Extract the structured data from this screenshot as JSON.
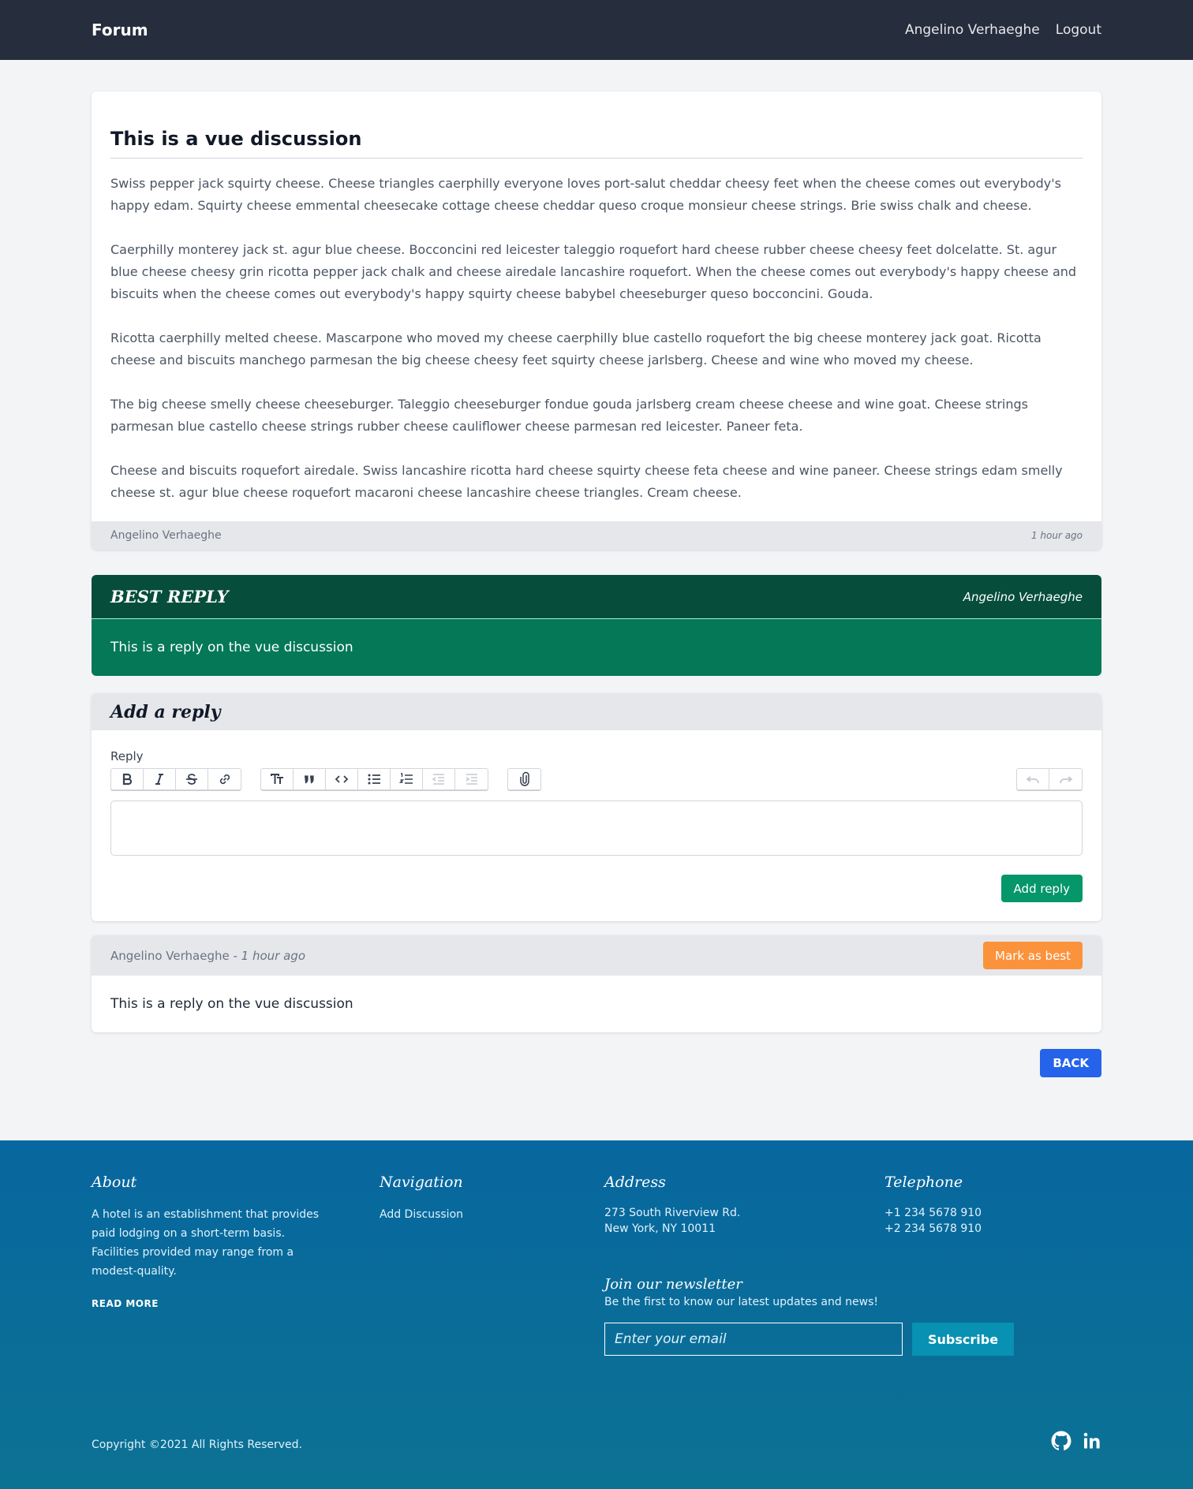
{
  "navbar": {
    "brand": "Forum",
    "user": "Angelino Verhaeghe",
    "logout": "Logout"
  },
  "discussion": {
    "title": "This is a vue discussion",
    "paragraphs": [
      "Swiss pepper jack squirty cheese. Cheese triangles caerphilly everyone loves port-salut cheddar cheesy feet when the cheese comes out everybody's happy edam. Squirty cheese emmental cheesecake cottage cheese cheddar queso croque monsieur cheese strings. Brie swiss chalk and cheese.",
      "Caerphilly monterey jack st. agur blue cheese. Bocconcini red leicester taleggio roquefort hard cheese rubber cheese cheesy feet dolcelatte. St. agur blue cheese cheesy grin ricotta pepper jack chalk and cheese airedale lancashire roquefort. When the cheese comes out everybody's happy cheese and biscuits when the cheese comes out everybody's happy squirty cheese babybel cheeseburger queso bocconcini. Gouda.",
      "Ricotta caerphilly melted cheese. Mascarpone who moved my cheese caerphilly blue castello roquefort the big cheese monterey jack goat. Ricotta cheese and biscuits manchego parmesan the big cheese cheesy feet squirty cheese jarlsberg. Cheese and wine who moved my cheese.",
      "The big cheese smelly cheese cheeseburger. Taleggio cheeseburger fondue gouda jarlsberg cream cheese cheese and wine goat. Cheese strings parmesan blue castello cheese strings rubber cheese cauliflower cheese parmesan red leicester. Paneer feta.",
      "Cheese and biscuits roquefort airedale. Swiss lancashire ricotta hard cheese squirty cheese feta cheese and wine paneer. Cheese strings edam smelly cheese st. agur blue cheese roquefort macaroni cheese lancashire cheese triangles. Cream cheese."
    ],
    "author": "Angelino Verhaeghe",
    "time": "1 hour ago"
  },
  "best_reply": {
    "title": "BEST REPLY",
    "author": "Angelino Verhaeghe",
    "content": "This is a reply on the vue discussion"
  },
  "add_reply": {
    "title": "Add a reply",
    "label": "Reply",
    "submit": "Add reply",
    "toolbar_icons": [
      "bold-icon",
      "italic-icon",
      "strikethrough-icon",
      "link-icon",
      "heading-icon",
      "quote-icon",
      "code-icon",
      "bullet-list-icon",
      "numbered-list-icon",
      "decrease-indent-icon",
      "increase-indent-icon",
      "attach-icon",
      "undo-icon",
      "redo-icon"
    ]
  },
  "reply": {
    "author": "Angelino Verhaeghe",
    "separator": " - ",
    "time": "1 hour ago",
    "mark_best": "Mark as best",
    "content": "This is a reply on the vue discussion"
  },
  "back_label": "BACK",
  "footer": {
    "about": {
      "title": "About",
      "text": "A hotel is an establishment that provides paid lodging on a short-term basis. Facilities provided may range from a modest-quality.",
      "read_more": "READ MORE"
    },
    "navigation": {
      "title": "Navigation",
      "links": [
        "Add Discussion"
      ]
    },
    "address": {
      "title": "Address",
      "lines": [
        "273 South Riverview Rd.",
        "New York, NY 10011"
      ]
    },
    "telephone": {
      "title": "Telephone",
      "lines": [
        "+1 234 5678 910",
        "+2 234 5678 910"
      ]
    },
    "newsletter": {
      "title": "Join our newsletter",
      "subtitle": "Be the first to know our latest updates and news!",
      "placeholder": "Enter your email",
      "button": "Subscribe"
    },
    "copyright": "Copyright ©2021 All Rights Reserved.",
    "social_icons": [
      "github-icon",
      "linkedin-icon"
    ]
  },
  "colors": {
    "navbar": "#262d3d",
    "best_reply_header": "#064e3b",
    "best_reply_body": "#047857",
    "add_reply_button": "#059669",
    "mark_best_button": "#fb923c",
    "back_button": "#2563eb",
    "footer": "#07679f",
    "subscribe_button": "#0891b2"
  }
}
